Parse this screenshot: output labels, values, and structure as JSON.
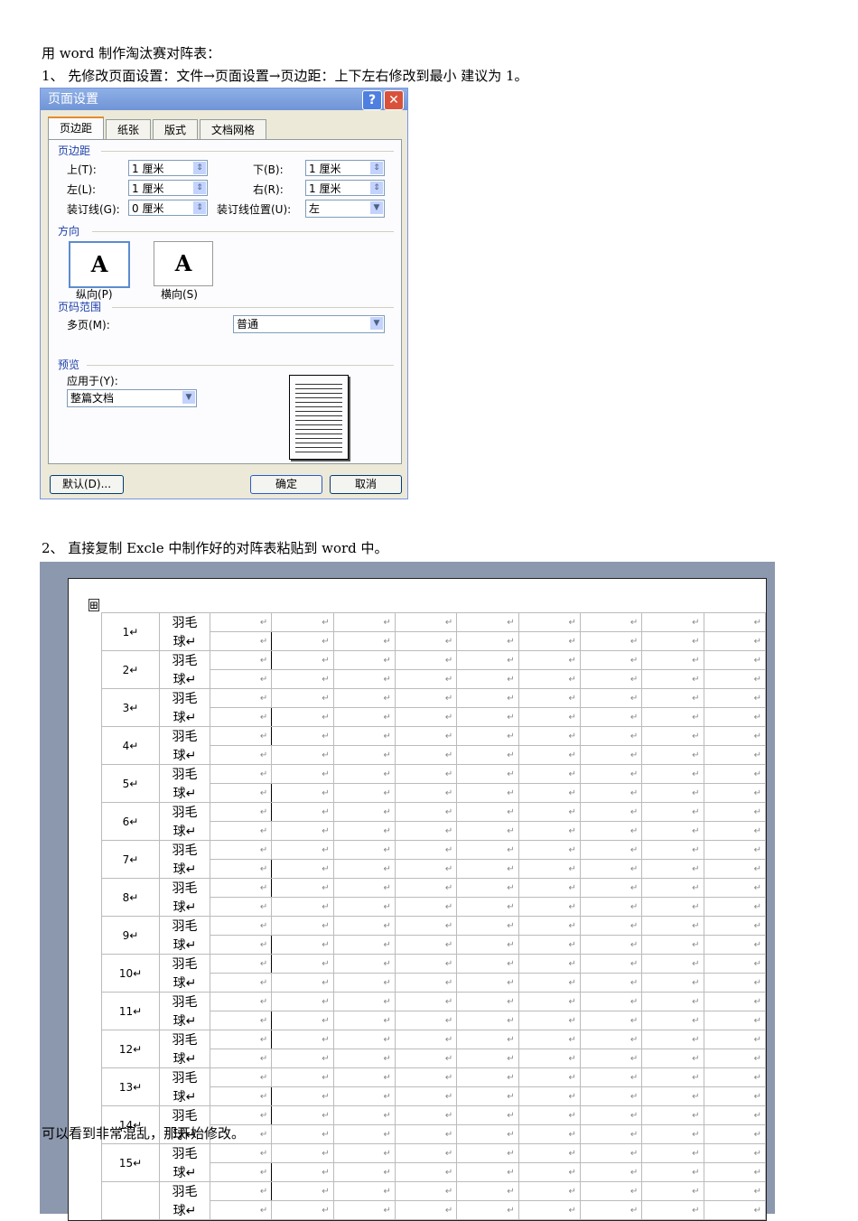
{
  "doc": {
    "title": "用 word 制作淘汰赛对阵表：",
    "step1": "1、 先修改页面设置：文件→页面设置→页边距：上下左右修改到最小 建议为 1。",
    "step2": "2、 直接复制 Excle 中制作好的对阵表粘贴到 word 中。",
    "note": "可以看到非常混乱，那开始修改。"
  },
  "dialog": {
    "title": "页面设置",
    "help": "?",
    "close": "✕",
    "tabs": [
      "页边距",
      "纸张",
      "版式",
      "文档网格"
    ],
    "margins_section": "页边距",
    "top_label": "上(T):",
    "top": "1 厘米",
    "bottom_label": "下(B):",
    "bottom": "1 厘米",
    "left_label": "左(L):",
    "left": "1 厘米",
    "right_label": "右(R):",
    "right": "1 厘米",
    "gutter_label": "装订线(G):",
    "gutter": "0 厘米",
    "gutter_pos_label": "装订线位置(U):",
    "gutter_pos": "左",
    "orientation_section": "方向",
    "portrait": "纵向(P)",
    "landscape": "横向(S)",
    "orient_glyph": "A",
    "pages_section": "页码范围",
    "multi_label": "多页(M):",
    "multi": "普通",
    "preview_section": "预览",
    "apply_label": "应用于(Y):",
    "apply": "整篇文档",
    "default_btn": "默认(D)...",
    "ok_btn": "确定",
    "cancel_btn": "取消"
  },
  "table": {
    "team_top": "羽毛",
    "team_bottom": "球↵",
    "mark": "↵",
    "teams": [
      "1↵",
      "2↵",
      "3↵",
      "4↵",
      "5↵",
      "6↵",
      "7↵",
      "8↵",
      "9↵",
      "10↵",
      "11↵",
      "12↵",
      "13↵",
      "14↵",
      "15↵",
      ""
    ],
    "move_handle": "⊞"
  }
}
